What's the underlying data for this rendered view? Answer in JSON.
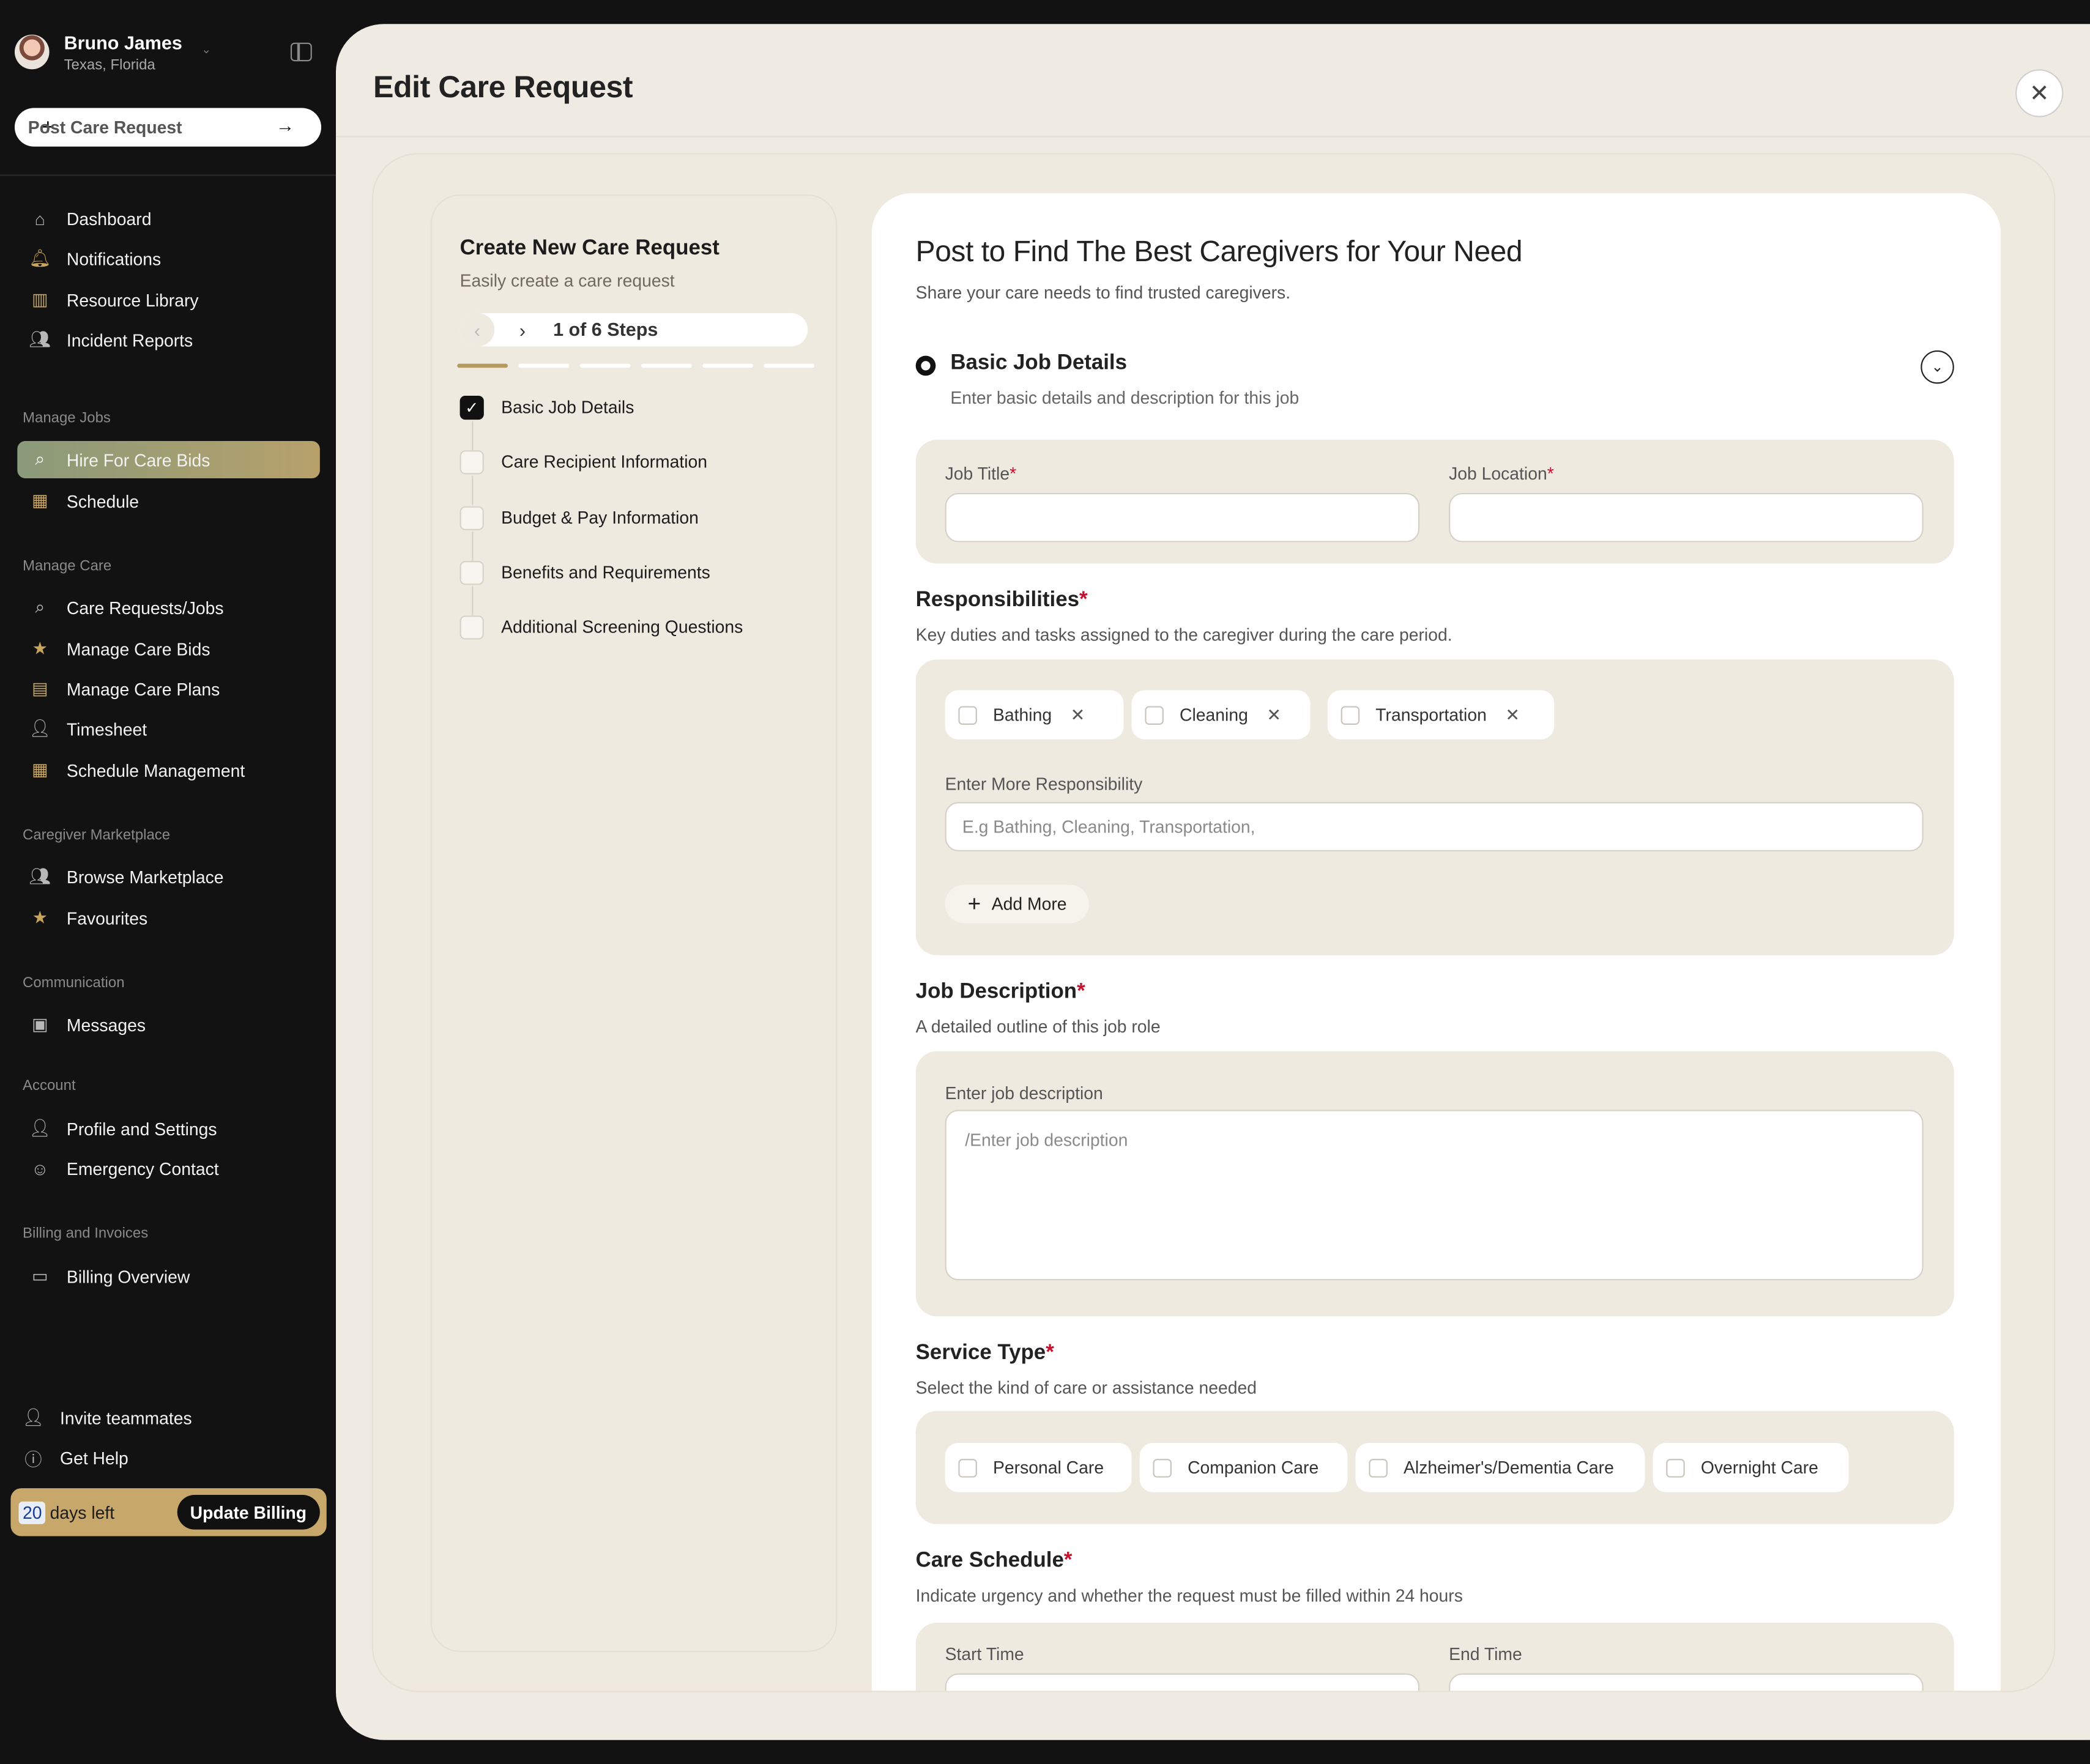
{
  "user": {
    "name": "Bruno James",
    "location": "Texas, Florida"
  },
  "sidebar": {
    "post_button": "Post Care Request",
    "items_top": [
      {
        "label": "Dashboard",
        "icon": "home-icon"
      },
      {
        "label": "Notifications",
        "icon": "bell-icon"
      },
      {
        "label": "Resource Library",
        "icon": "book-icon"
      },
      {
        "label": "Incident Reports",
        "icon": "users-icon"
      }
    ],
    "sections": [
      {
        "label": "Manage Jobs",
        "items": [
          {
            "label": "Hire For Care Bids",
            "icon": "search-icon",
            "active": true
          },
          {
            "label": "Schedule",
            "icon": "calendar-icon"
          }
        ]
      },
      {
        "label": "Manage Care",
        "items": [
          {
            "label": "Care Requests/Jobs",
            "icon": "search-icon"
          },
          {
            "label": "Manage Care Bids",
            "icon": "star-icon"
          },
          {
            "label": "Manage Care Plans",
            "icon": "briefcase-icon"
          },
          {
            "label": "Timesheet",
            "icon": "user-icon"
          },
          {
            "label": "Schedule Management",
            "icon": "calendar-icon"
          }
        ]
      },
      {
        "label": "Caregiver Marketplace",
        "items": [
          {
            "label": "Browse Marketplace",
            "icon": "users-icon"
          },
          {
            "label": "Favourites",
            "icon": "star-icon"
          }
        ]
      },
      {
        "label": "Communication",
        "items": [
          {
            "label": "Messages",
            "icon": "chat-icon"
          }
        ]
      },
      {
        "label": "Account",
        "items": [
          {
            "label": "Profile and Settings",
            "icon": "user-icon"
          },
          {
            "label": "Emergency Contact",
            "icon": "contact-icon"
          }
        ]
      },
      {
        "label": "Billing and Invoices",
        "items": [
          {
            "label": "Billing Overview",
            "icon": "card-icon"
          }
        ]
      }
    ],
    "invite": "Invite teammates",
    "help": "Get Help",
    "billing": {
      "days": "20",
      "days_label": "days left",
      "button": "Update Billing"
    }
  },
  "modal": {
    "title": "Edit Care Request"
  },
  "stepper": {
    "title": "Create New Care Request",
    "subtitle": "Easily create a care request",
    "pager": "1 of 6 Steps",
    "steps": [
      {
        "label": "Basic Job Details",
        "done": true
      },
      {
        "label": "Care Recipient Information",
        "done": false
      },
      {
        "label": "Budget & Pay Information",
        "done": false
      },
      {
        "label": "Benefits and Requirements",
        "done": false
      },
      {
        "label": "Additional Screening Questions",
        "done": false
      }
    ]
  },
  "form": {
    "title": "Post to Find The Best Caregivers for Your Need",
    "subtitle": "Share your care needs to find trusted caregivers.",
    "section": {
      "title": "Basic Job Details",
      "subtitle": "Enter basic details and description for this job"
    },
    "job_title_label": "Job Title",
    "job_location_label": "Job Location",
    "required_mark": "*",
    "responsibilities": {
      "title": "Responsibilities",
      "subtitle": "Key duties and tasks assigned to the caregiver during the care period.",
      "chips": [
        "Bathing",
        "Cleaning",
        "Transportation"
      ],
      "more_label": "Enter More Responsibility",
      "more_placeholder": "E.g Bathing, Cleaning, Transportation,",
      "add_more": "Add More"
    },
    "description": {
      "title": "Job Description",
      "subtitle": "A detailed outline of this job role",
      "label": "Enter job description",
      "placeholder": "/Enter job description"
    },
    "service_type": {
      "title": "Service Type",
      "subtitle": "Select the kind of care or assistance needed",
      "options": [
        "Personal Care",
        "Companion Care",
        "Alzheimer's/Dementia Care",
        "Overnight Care"
      ]
    },
    "schedule": {
      "title": "Care Schedule",
      "subtitle": "Indicate urgency and whether the request must be filled within 24 hours",
      "start_label": "Start Time",
      "end_label": "End Time"
    }
  }
}
